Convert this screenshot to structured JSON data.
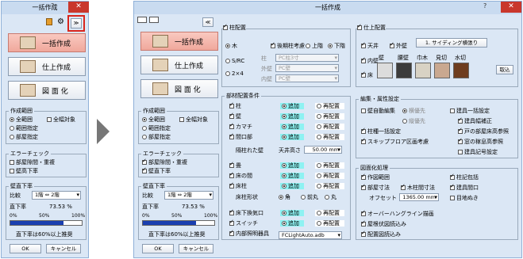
{
  "arrow_icon": "right-triangle-arrow",
  "colors": {
    "window_bg": "#dbe7f5",
    "title_bg": "#c9dbf0",
    "close": "#c9372c",
    "highlight": "#8ef2f2",
    "active_btn": "#f0a89c",
    "red_frame": "#d9251d",
    "progress": "#1a3fb0"
  },
  "small": {
    "title": "一括作成",
    "qm": "?",
    "close": "✕",
    "expand": "≫",
    "btn_all": "一括作成",
    "btn_finish": "仕上作成",
    "btn_fig": "図 面 化",
    "range_title": "作成範囲",
    "r_all": "全範囲",
    "r_scope": "範囲指定",
    "r_room": "部屋指定",
    "c_all_target": "全幅対象",
    "err_title": "エラーチェック",
    "e_gap": "部屋隙間・重複",
    "e_floor": "壁高下率",
    "wall_title": "壁直下率",
    "compare": "比較",
    "compare_val": "1階 ⇔ 2階",
    "rate_label": "直下率",
    "rate_val": "73.53 %",
    "scale": [
      "0%",
      "50%",
      "100%"
    ],
    "progress": 0.74,
    "note": "直下率は60%以上推奨",
    "ok": "OK",
    "cancel": "キャンセル"
  },
  "big": {
    "title": "一括作成",
    "qm": "?",
    "close": "✕",
    "collapse": "≪",
    "btn_all": "一括作成",
    "btn_finish": "仕上作成",
    "btn_fig": "図 面 化",
    "range_title": "作成範囲",
    "r_all": "全範囲",
    "r_scope": "範囲指定",
    "r_room": "部屋指定",
    "c_all_target": "全幅対象",
    "err_title": "エラーチェック",
    "e_gap": "部屋隙間・重複",
    "e_floor": "壁直下率",
    "wall_title": "壁直下率",
    "compare": "比較",
    "compare_val": "1階 ⇔ 2階",
    "rate_label": "直下率",
    "rate_val": "73.53 %",
    "scale": [
      "0%",
      "50%",
      "100%"
    ],
    "progress": 0.74,
    "note": "直下率は60%以上推奨",
    "ok": "OK",
    "cancel": "キャンセル",
    "pillar": {
      "title": "柱配置",
      "wood": "木",
      "src": "S/RC",
      "twobyfour": "2×4",
      "mgr": "後期柱考慮",
      "upper": "上階",
      "lower": "下階",
      "col": "柱",
      "col_val": "PC柱3寸",
      "outer": "外壁",
      "outer_val": "PC壁",
      "inner": "内壁",
      "inner_val": "PC壁"
    },
    "cond": {
      "title": "部材配置条件",
      "add": "追加",
      "replace": "再配置",
      "rows": [
        "柱",
        "壁",
        "カマチ",
        "間口部"
      ],
      "lintel": "隔柱れた壁",
      "ceil": "天井高さ",
      "ceil_val": "50.00 mm",
      "rows2": [
        "畳",
        "床の間",
        "床柱"
      ],
      "pshape": "床柱形状",
      "round": "角",
      "semi": "前丸",
      "full": "丸",
      "rows3": [
        "床下換気口",
        "スイッチ",
        "内部照明器具"
      ],
      "light_val": "FCLightAuto.adb"
    },
    "finish": {
      "title": "仕上配置",
      "ceiling": "天井",
      "outer": "外壁",
      "sidefx": "1. サイディング横張り",
      "inwall": "内壁",
      "floor": "床",
      "mats": [
        "壁",
        "腰壁",
        "巾木",
        "見切",
        "水切"
      ],
      "pick": "取込"
    },
    "edit": {
      "title": "編集・属性設定",
      "autowall": "壁自動編集",
      "sub1": "横優先",
      "sub2": "縦優先",
      "pil_head": "柱種一括設定",
      "skip": "スキップフロア区画考慮",
      "fit": "建具一括設定",
      "fit2": "建具幅補正",
      "open": "戸の部屋床高参照",
      "win": "窓の稼息高参照",
      "mark": "建具記号設定"
    },
    "plan": {
      "title": "図面化処理",
      "area": "作図範囲",
      "wdim": "部屋寸法",
      "col_dim": "木柱間寸法",
      "offset": "オフセット",
      "offset_val": "1365.00 mm",
      "pil_pack": "柱記包括",
      "fit_pack": "建具間口",
      "bottom": "目地ぬき",
      "over": "オーバーハングライン描画",
      "roof": "屋根伏図読込み",
      "layout": "配置図読込み"
    }
  }
}
